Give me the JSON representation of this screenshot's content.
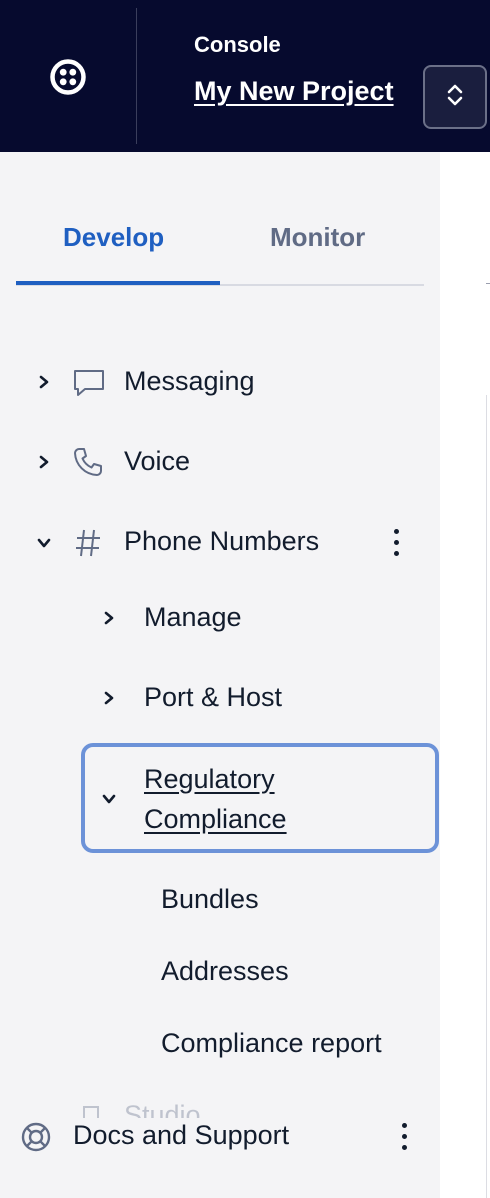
{
  "header": {
    "logo_icon": "twilio-logo-icon",
    "console_label": "Console",
    "project_name": "My New Project",
    "switcher_icon": "chevron-up-down-icon"
  },
  "tabs": [
    {
      "label": "Develop",
      "active": true
    },
    {
      "label": "Monitor",
      "active": false
    }
  ],
  "nav": {
    "messaging": {
      "label": "Messaging",
      "icon": "chat-bubble-icon",
      "expanded": false
    },
    "voice": {
      "label": "Voice",
      "icon": "phone-icon",
      "expanded": false
    },
    "phone_numbers": {
      "label": "Phone Numbers",
      "icon": "hash-icon",
      "expanded": true,
      "children": {
        "manage": {
          "label": "Manage",
          "expanded": false
        },
        "port_host": {
          "label": "Port & Host",
          "expanded": false
        },
        "regulatory": {
          "label_line1": "Regulatory",
          "label_line2": "Compliance",
          "expanded": true,
          "items": [
            "Bundles",
            "Addresses",
            "Compliance report"
          ]
        }
      }
    },
    "ghost_item": {
      "label": "Studio"
    }
  },
  "footer": {
    "docs_label": "Docs and Support",
    "docs_icon": "lifebuoy-icon"
  },
  "colors": {
    "topbar": "#060a2e",
    "sidebar": "#f4f4f6",
    "accent": "#1f5fc1",
    "focus_ring": "#6c92d8",
    "text": "#121c2d",
    "muted": "#606b85"
  }
}
